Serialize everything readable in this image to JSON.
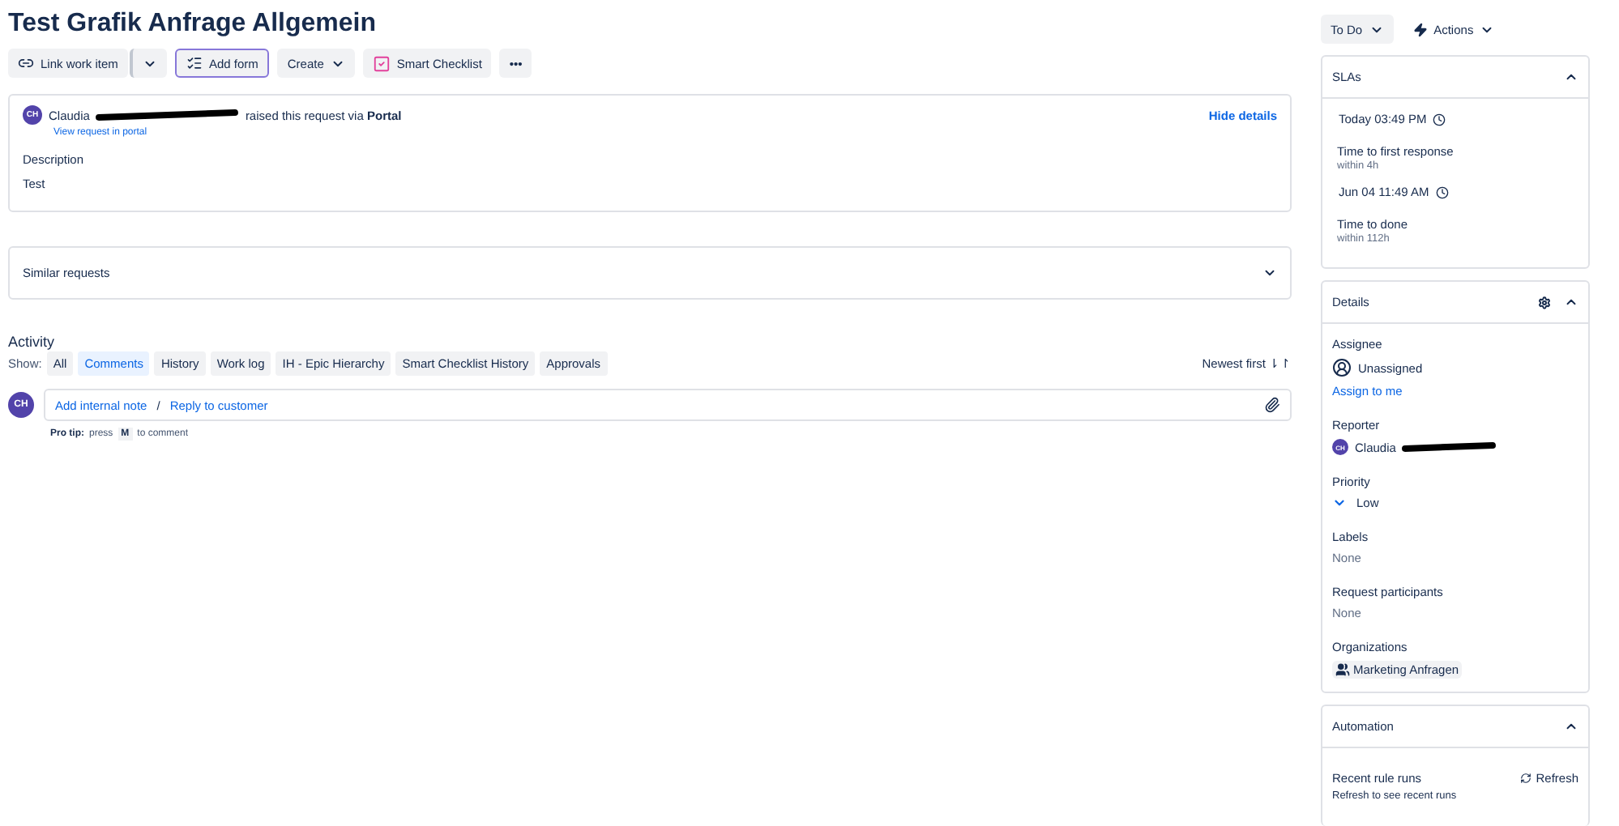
{
  "title": "Test Grafik Anfrage Allgemein",
  "toolbar": [
    {
      "kind": "link",
      "label": "Link work item"
    },
    {
      "kind": "form",
      "label": "Add form"
    },
    {
      "kind": "dropdown",
      "label": "Create"
    },
    {
      "kind": "checklist",
      "label": "Smart Checklist"
    },
    {
      "kind": "more",
      "label": "•••"
    }
  ],
  "request": {
    "avatar": "CH",
    "name": "Claudia",
    "text": "raised this request via **Portal**",
    "link": "View request in portal",
    "hide": "Hide details",
    "description_label": "Description",
    "description": "Test"
  },
  "similar": {
    "label": "Similar requests",
    "expanded": false
  },
  "activity": {
    "title": "Activity",
    "show": "Show:",
    "sort": "Newest first ⇂↾",
    "filters": [
      {
        "label": "All",
        "selected": false
      },
      {
        "label": "Comments",
        "selected": true
      },
      {
        "label": "History",
        "selected": false
      },
      {
        "label": "Work log",
        "selected": false
      },
      {
        "label": "IH - Epic Hierarchy",
        "selected": false
      },
      {
        "label": "Smart Checklist History",
        "selected": false
      },
      {
        "label": "Approvals",
        "selected": false
      }
    ],
    "avatar": "CH",
    "add_note": "Add internal note",
    "separator": "/",
    "reply": "Reply to customer",
    "tip_label": "Pro tip:",
    "tip_press": "press",
    "tip_key": "M",
    "tip_rest": "to comment"
  },
  "status": {
    "label": "To Do",
    "actions": "Actions"
  },
  "slas": {
    "title": "SLAs",
    "expanded": true,
    "items": [
      {
        "time": "Today 03:49 PM",
        "name": "Time to first response",
        "within": "within 4h"
      },
      {
        "time": "Jun 04 11:49 AM",
        "name": "Time to done",
        "within": "within 112h"
      }
    ]
  },
  "details": {
    "title": "Details",
    "expanded": true,
    "fields": [
      {
        "kind": "assignee",
        "label": "Assignee",
        "value": "Unassigned",
        "link": "Assign to me"
      },
      {
        "kind": "reporter",
        "label": "Reporter",
        "avatar": "CH",
        "value": "Claudia"
      },
      {
        "kind": "priority",
        "label": "Priority",
        "value": "Low"
      },
      {
        "kind": "none",
        "label": "Labels",
        "value": "None"
      },
      {
        "kind": "none",
        "label": "Request participants",
        "value": "None"
      },
      {
        "kind": "org",
        "label": "Organizations",
        "value": "Marketing Anfragen"
      }
    ]
  },
  "automation": {
    "title": "Automation",
    "expanded": true,
    "runs": "Recent rule runs",
    "refresh": "Refresh",
    "hint": "Refresh to see recent runs"
  }
}
